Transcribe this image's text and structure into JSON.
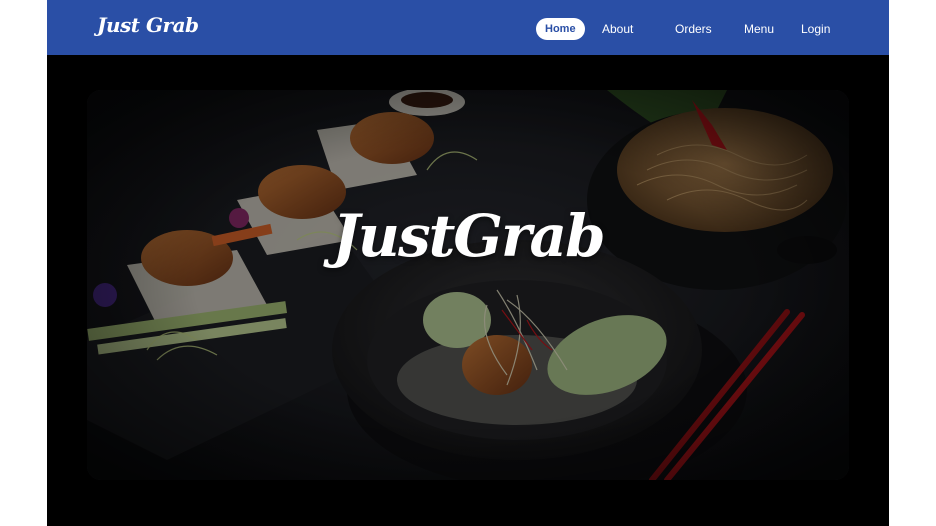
{
  "brand": {
    "logo_text": "Just Grab"
  },
  "nav": {
    "items": [
      {
        "label": "Home",
        "active": true
      },
      {
        "label": "About",
        "active": false
      },
      {
        "label": "Orders",
        "active": false
      },
      {
        "label": "Menu",
        "active": false
      },
      {
        "label": "Login",
        "active": false
      }
    ]
  },
  "hero": {
    "title": "JustGrab",
    "image": "food-photo-roast-duck-noodles-chopsticks"
  },
  "colors": {
    "navbar": "#2a4fa6",
    "page_background": "#000000",
    "active_pill_bg": "#ffffff",
    "active_pill_text": "#2a4fa6",
    "chopsticks": "#c0161c"
  }
}
